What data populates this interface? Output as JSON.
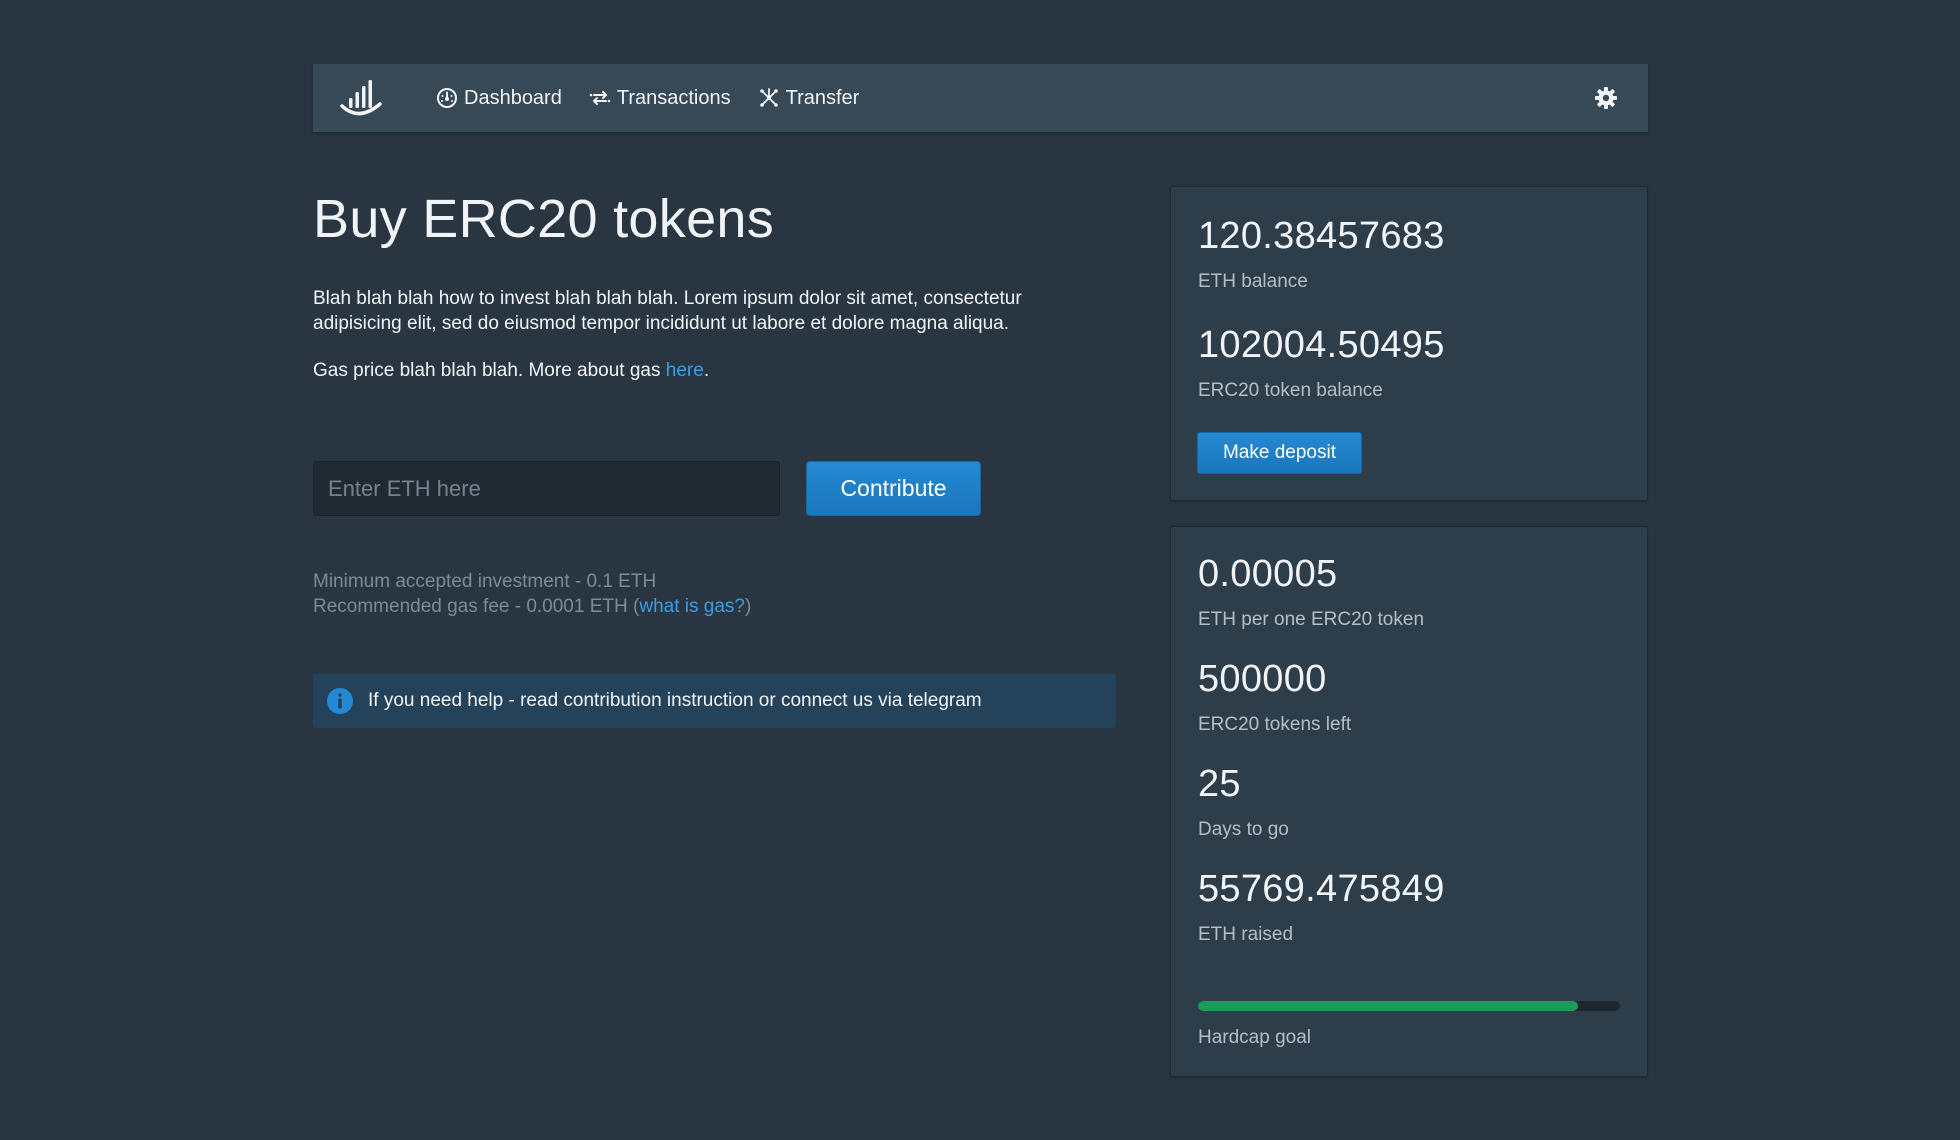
{
  "nav": {
    "items": [
      {
        "label": "Dashboard",
        "icon": "gauge-icon"
      },
      {
        "label": "Transactions",
        "icon": "transactions-icon"
      },
      {
        "label": "Transfer",
        "icon": "transfer-icon"
      }
    ],
    "settings_icon": "gear-icon",
    "logo_icon": "bars-logo-icon"
  },
  "main": {
    "title": "Buy ERC20 tokens",
    "intro": "Blah blah blah how to invest blah blah blah. Lorem ipsum dolor sit amet, consectetur adipisicing elit, sed do eiusmod tempor incididunt ut labore et dolore magna aliqua.",
    "gas_text": "Gas price blah blah blah. More about gas ",
    "gas_link": "here",
    "gas_suffix": ".",
    "input_placeholder": "Enter ETH here",
    "input_value": "",
    "contribute_label": "Contribute",
    "min_investment": "Minimum accepted investment - 0.1 ETH",
    "gas_fee_prefix": "Recommended gas fee - 0.0001 ETH (",
    "gas_fee_link": "what is gas?",
    "gas_fee_suffix": ")",
    "help_text": "If you need help - read contribution instruction or connect us via telegram"
  },
  "balance_card": {
    "eth_balance": "120.38457683",
    "eth_balance_label": "ETH balance",
    "token_balance": "102004.50495",
    "token_balance_label": "ERC20 token balance",
    "deposit_label": "Make deposit"
  },
  "stats_card": {
    "price": "0.00005",
    "price_label": "ETH per one ERC20 token",
    "tokens_left": "500000",
    "tokens_left_label": "ERC20 tokens left",
    "days": "25",
    "days_label": "Days to go",
    "raised": "55769.475849",
    "raised_label": "ETH raised",
    "hardcap_progress": 0.9,
    "hardcap_label": "Hardcap goal"
  },
  "colors": {
    "background": "#293642",
    "navbar": "#374856",
    "card": "#2e3d4a",
    "accent": "#1f80c9",
    "link": "#3a9ee3",
    "progress": "#1a9b5b"
  }
}
